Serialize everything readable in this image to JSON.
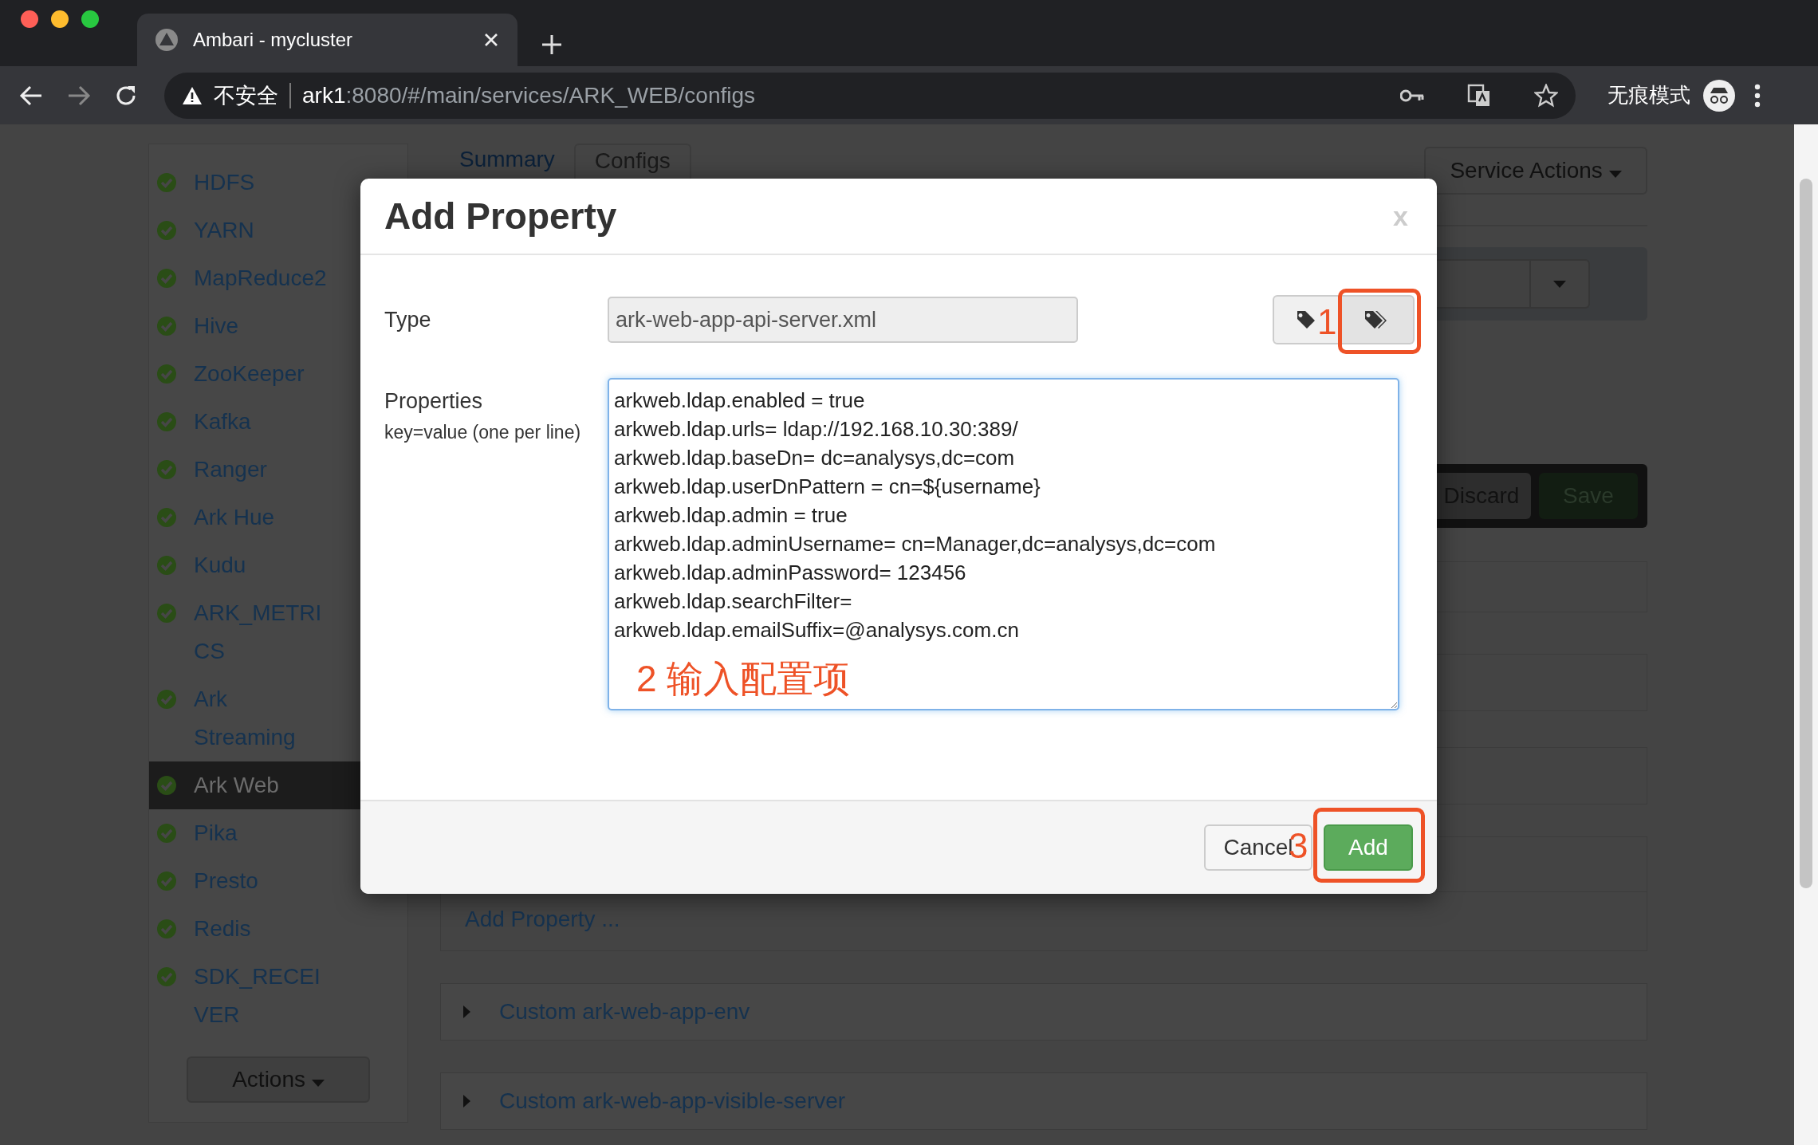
{
  "browser": {
    "tab_title": "Ambari - mycluster",
    "security_label": "不安全",
    "url_host": "ark1",
    "url_path": ":8080/#/main/services/ARK_WEB/configs",
    "profile_label": "无痕模式"
  },
  "sidebar": {
    "items": [
      {
        "label": "HDFS",
        "selected": false
      },
      {
        "label": "YARN",
        "selected": false
      },
      {
        "label": "MapReduce2",
        "selected": false
      },
      {
        "label": "Hive",
        "selected": false
      },
      {
        "label": "ZooKeeper",
        "selected": false
      },
      {
        "label": "Kafka",
        "selected": false
      },
      {
        "label": "Ranger",
        "selected": false
      },
      {
        "label": "Ark Hue",
        "selected": false
      },
      {
        "label": "Kudu",
        "selected": false
      },
      {
        "label": "ARK_METRICS",
        "selected": false
      },
      {
        "label": "Ark Streaming",
        "selected": false
      },
      {
        "label": "Ark Web",
        "selected": true
      },
      {
        "label": "Pika",
        "selected": false
      },
      {
        "label": "Presto",
        "selected": false
      },
      {
        "label": "Redis",
        "selected": false
      },
      {
        "label": "SDK_RECEIVER",
        "selected": false
      }
    ],
    "actions_button": "Actions"
  },
  "main": {
    "tabs": [
      {
        "label": "Summary",
        "selected": false
      },
      {
        "label": "Configs",
        "selected": true
      }
    ],
    "service_actions": "Service Actions",
    "discard": "Discard",
    "save": "Save",
    "add_property_link": "Add Property ...",
    "sections": [
      "Custom ark-web-app-env",
      "Custom ark-web-app-visible-server"
    ]
  },
  "dialog": {
    "title": "Add Property",
    "close": "x",
    "type_label": "Type",
    "type_value": "ark-web-app-api-server.xml",
    "properties_label": "Properties",
    "properties_hint": "key=value (one per line)",
    "properties_value": [
      "arkweb.ldap.enabled = true",
      "arkweb.ldap.urls= ldap://192.168.10.30:389/",
      "arkweb.ldap.baseDn= dc=analysys,dc=com",
      "arkweb.ldap.userDnPattern = cn=${username}",
      "arkweb.ldap.admin = true",
      "arkweb.ldap.adminUsername= cn=Manager,dc=analysys,dc=com",
      "arkweb.ldap.adminPassword= 123456",
      "arkweb.ldap.searchFilter=",
      "arkweb.ldap.emailSuffix=@analysys.com.cn"
    ],
    "cancel": "Cancel",
    "add": "Add"
  },
  "annotations": [
    "1",
    "2 输入配置项",
    "3"
  ]
}
